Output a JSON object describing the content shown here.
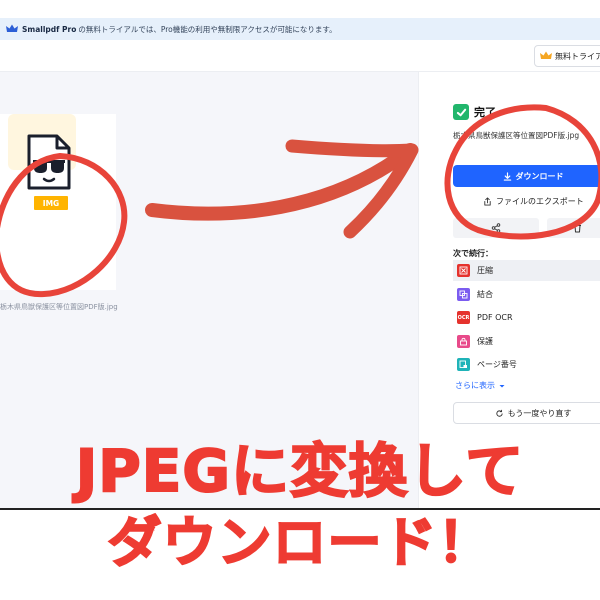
{
  "banner": {
    "brand": "Smallpdf Pro",
    "message": "の無料トライアルでは、Pro機能の利用や無制限アクセスが可能になります。"
  },
  "header": {
    "trial_label": "無料トライアル"
  },
  "preview": {
    "badge": "IMG",
    "filename": "栃木県鳥獣保護区等位置図PDF版.jpg"
  },
  "panel": {
    "status": "完了",
    "filename": "栃木県鳥獣保護区等位置図PDF版.jpg",
    "download_label": "ダウンロード",
    "export_label": "ファイルのエクスポート",
    "next_label": "次で続行：",
    "tools": [
      {
        "label": "圧縮",
        "icon": "compress-icon",
        "color": "#e5322d"
      },
      {
        "label": "結合",
        "icon": "merge-icon",
        "color": "#7b5cf0"
      },
      {
        "label": "PDF OCR",
        "icon": "ocr-icon",
        "color": "#e5322d",
        "icon_text": "OCR"
      },
      {
        "label": "保護",
        "icon": "lock-icon",
        "color": "#e84a8a"
      },
      {
        "label": "ページ番号",
        "icon": "page-number-icon",
        "color": "#1fb3b8"
      }
    ],
    "more_label": "さらに表示",
    "retry_label": "もう一度やり直す"
  },
  "caption": {
    "line1": "JPEGに変換して",
    "line2": "ダウンロード！"
  },
  "colors": {
    "accent": "#1f64ff",
    "success": "#21b66c",
    "annotation": "#ee3b32",
    "badge": "#ffb400"
  }
}
